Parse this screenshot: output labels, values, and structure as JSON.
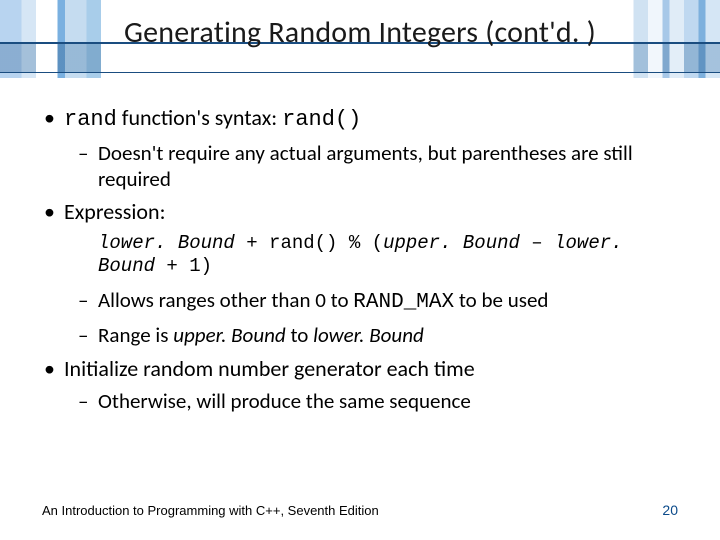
{
  "title": "Generating Random Integers (cont'd. )",
  "bullets": {
    "b1a_pre": "rand",
    "b1a_mid": " function's syntax: ",
    "b1a_post": "rand()",
    "b1a_sub1": "Doesn't require any actual arguments, but parentheses are still required",
    "b1b": "Expression:",
    "expr_lb": "lower. Bound",
    "expr_plus": " + ",
    "expr_rand": "rand() % (",
    "expr_ub": "upper. Bound",
    "expr_minus": " – ",
    "expr_lb2": "lower. Bound",
    "expr_end": " + 1)",
    "b1b_sub1_pre": "Allows ranges other than 0 to ",
    "b1b_sub1_code": "RAND_MAX",
    "b1b_sub1_post": " to be used",
    "b1b_sub2_pre": "Range is ",
    "b1b_sub2_ub": "upper. Bound",
    "b1b_sub2_mid": " to ",
    "b1b_sub2_lb": "lower. Bound",
    "b1c": "Initialize random number generator each time",
    "b1c_sub1": "Otherwise, will produce the same sequence"
  },
  "footer": {
    "left": "An Introduction to Programming with C++, Seventh Edition",
    "right": "20"
  }
}
